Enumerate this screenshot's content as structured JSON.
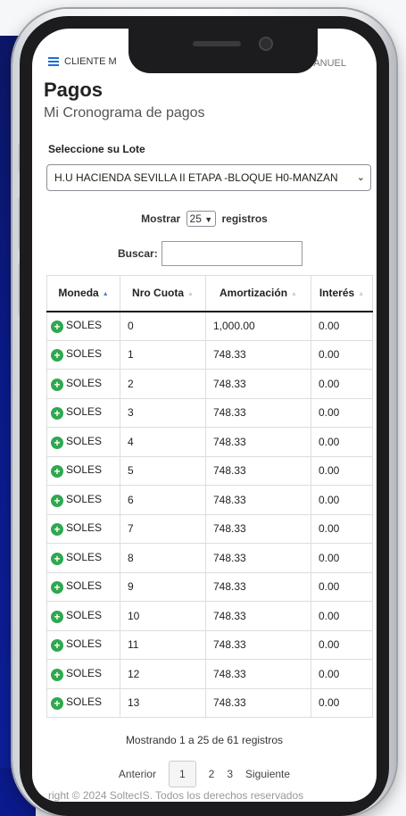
{
  "app": {
    "header_label": "CLIENTE M",
    "user_name": "MANUEL"
  },
  "page": {
    "title": "Pagos",
    "subtitle": "Mi Cronograma de pagos"
  },
  "lote": {
    "label": "Seleccione su Lote",
    "selected": "H.U HACIENDA SEVILLA II ETAPA -BLOQUE H0-MANZAN"
  },
  "length_menu": {
    "prefix": "Mostrar",
    "value": "25",
    "suffix": "registros"
  },
  "search": {
    "label": "Buscar:",
    "value": ""
  },
  "table": {
    "columns": [
      "Moneda",
      "Nro Cuota",
      "Amortización",
      "Interés"
    ],
    "rows": [
      [
        "SOLES",
        "0",
        "1,000.00",
        "0.00"
      ],
      [
        "SOLES",
        "1",
        "748.33",
        "0.00"
      ],
      [
        "SOLES",
        "2",
        "748.33",
        "0.00"
      ],
      [
        "SOLES",
        "3",
        "748.33",
        "0.00"
      ],
      [
        "SOLES",
        "4",
        "748.33",
        "0.00"
      ],
      [
        "SOLES",
        "5",
        "748.33",
        "0.00"
      ],
      [
        "SOLES",
        "6",
        "748.33",
        "0.00"
      ],
      [
        "SOLES",
        "7",
        "748.33",
        "0.00"
      ],
      [
        "SOLES",
        "8",
        "748.33",
        "0.00"
      ],
      [
        "SOLES",
        "9",
        "748.33",
        "0.00"
      ],
      [
        "SOLES",
        "10",
        "748.33",
        "0.00"
      ],
      [
        "SOLES",
        "11",
        "748.33",
        "0.00"
      ],
      [
        "SOLES",
        "12",
        "748.33",
        "0.00"
      ],
      [
        "SOLES",
        "13",
        "748.33",
        "0.00"
      ]
    ]
  },
  "info": "Mostrando 1 a 25 de 61 registros",
  "pagination": {
    "previous": "Anterior",
    "pages": [
      "1",
      "2",
      "3"
    ],
    "next": "Siguiente"
  },
  "footer_partial": "right © 2024 SoltecIS. Todos los derechos reservados",
  "colors": {
    "accent": "#1e6fd9",
    "expand_green": "#2fa84f",
    "background_blue": "#0d1f9b"
  }
}
